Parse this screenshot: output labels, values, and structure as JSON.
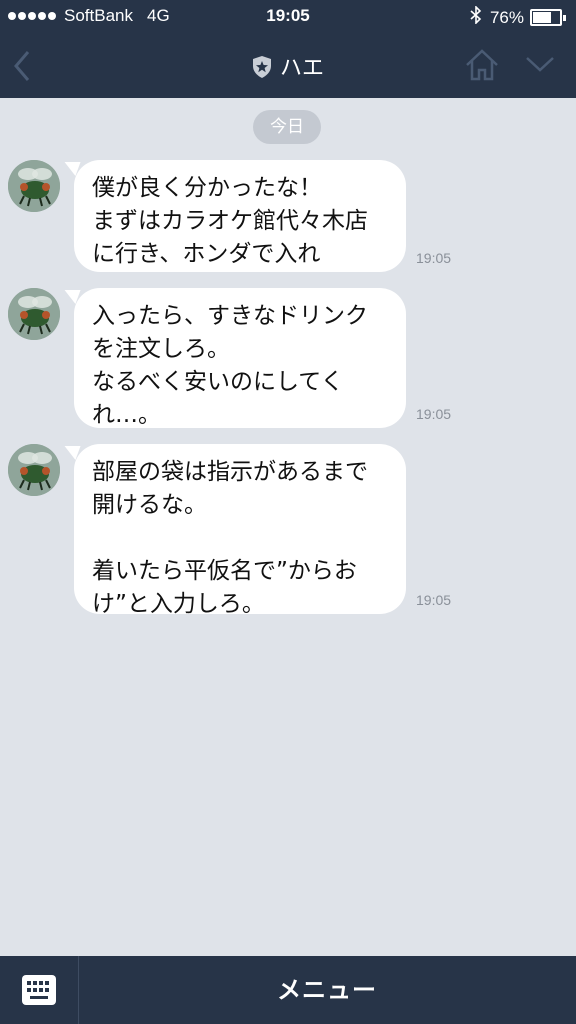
{
  "status_bar": {
    "carrier": "SoftBank",
    "network": "4G",
    "time": "19:05",
    "battery_percent": "76%",
    "battery_level": 0.76
  },
  "header": {
    "title": "ハエ"
  },
  "chat": {
    "date_label": "今日",
    "messages": [
      {
        "text": "僕が良く分かったな！\nまずはカラオケ館代々木店\nに行き、ホンダで入れ",
        "time": "19:05"
      },
      {
        "text": "入ったら、すきなドリンク\nを注文しろ。\nなるべく安いのにしてく\nれ…。",
        "time": "19:05"
      },
      {
        "text": "部屋の袋は指示があるまで\n開けるな。\n\n着いたら平仮名で”からお\nけ”と入力しろ。",
        "time": "19:05"
      }
    ]
  },
  "bottom_bar": {
    "menu_label": "メニュー"
  },
  "icons": {
    "back": "chevron-left-icon",
    "official": "shield-star-icon",
    "home": "home-icon",
    "dropdown": "chevron-down-icon",
    "keyboard": "keyboard-icon"
  },
  "colors": {
    "header_bg": "#273448",
    "chat_bg": "#dfe3e9",
    "bubble_bg": "#ffffff"
  }
}
